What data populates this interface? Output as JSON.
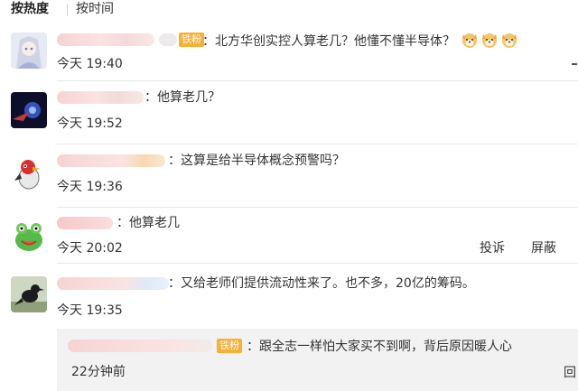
{
  "sort_tabs": {
    "hot": "按热度",
    "time": "按时间"
  },
  "comments": [
    {
      "text": "：北方华创实控人算老几？他懂不懂半导体？",
      "time": "今天 19:40",
      "badge": "铁粉",
      "emoji_count": 3
    },
    {
      "text": "：他算老几？",
      "time": "今天 19:52"
    },
    {
      "text": "：这算是给半导体概念预警吗？",
      "time": "今天 19:36"
    },
    {
      "text": "：他算老几",
      "time": "今天 20:02",
      "actions": [
        "投诉",
        "屏蔽"
      ]
    },
    {
      "text": "：又给老师们提供流动性来了。也不多，20亿的筹码。",
      "time": "今天 19:35"
    }
  ],
  "reply": {
    "badge": "铁粉",
    "text": "：跟全志一样怕大家买不到啊，背后原因暖人心",
    "time": "22分钟前",
    "edge_text": "回"
  },
  "colors": {
    "badge": "#f7b035",
    "reply_bg": "#f2f2f2"
  }
}
